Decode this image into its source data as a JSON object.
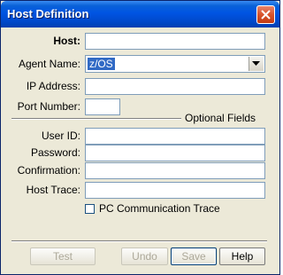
{
  "window": {
    "title": "Host Definition"
  },
  "form": {
    "host_label": "Host:",
    "host_value": "",
    "agent_label": "Agent Name:",
    "agent_value": "z/OS",
    "ip_label": "IP Address:",
    "ip_value": "",
    "port_label": "Port Number:",
    "port_value": "",
    "section_label": "Optional Fields",
    "userid_label": "User ID:",
    "userid_value": "",
    "password_label": "Password:",
    "password_value": "",
    "confirmation_label": "Confirmation:",
    "confirmation_value": "",
    "hosttrace_label": "Host Trace:",
    "hosttrace_value": "",
    "pc_trace_label": "PC Communication Trace",
    "pc_trace_checked": false
  },
  "buttons": {
    "test": "Test",
    "undo": "Undo",
    "save": "Save",
    "help": "Help"
  },
  "colors": {
    "title_bar": "#0054e3",
    "close_button": "#d8532c",
    "selection": "#316ac5",
    "dialog_bg": "#ece9d8"
  }
}
